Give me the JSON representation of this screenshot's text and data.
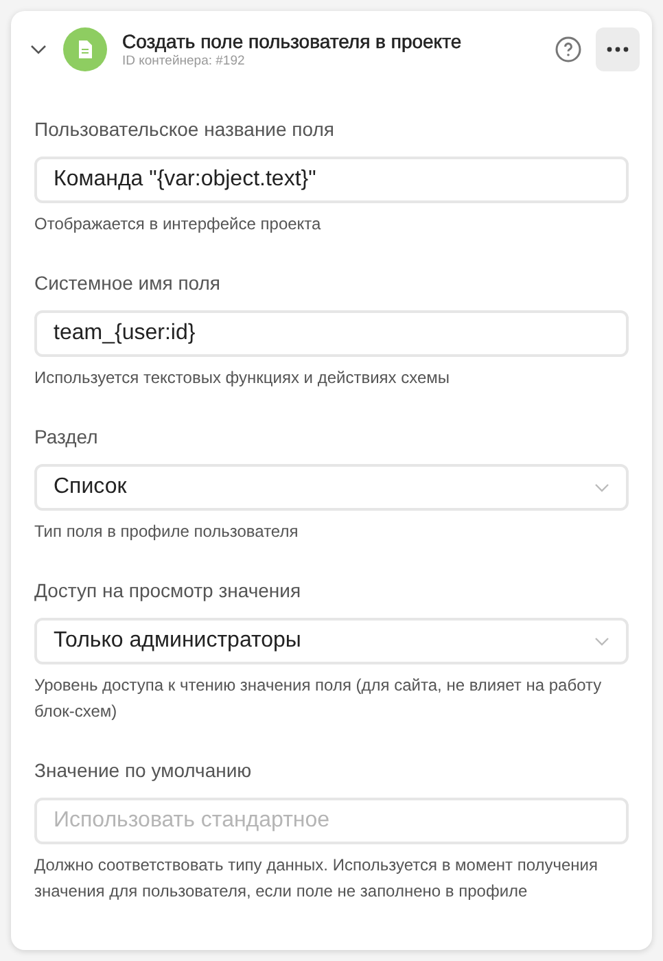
{
  "header": {
    "title": "Создать поле пользователя в проекте",
    "subtitle": "ID контейнера: #192",
    "expanded": true
  },
  "fields": [
    {
      "kind": "text",
      "label": "Пользовательское название поля",
      "value": "Команда \"{var:object.text}\"",
      "hint": "Отображается в интерфейсе проекта"
    },
    {
      "kind": "text",
      "label": "Системное имя поля",
      "value": "team_{user:id}",
      "hint": "Используется текстовых функциях и действиях схемы"
    },
    {
      "kind": "select",
      "label": "Раздел",
      "value": "Список",
      "hint": "Тип поля в профиле пользователя"
    },
    {
      "kind": "select",
      "label": "Доступ на просмотр значения",
      "value": "Только администраторы",
      "hint": "Уровень доступа к чтению значения поля (для сайта, не влияет на работу блок-схем)"
    },
    {
      "kind": "text",
      "label": "Значение по умолчанию",
      "placeholder": "Использовать стандартное",
      "hint": "Должно соответствовать типу данных. Используется в момент получения значения для пользователя, если поле не заполнено в профиле"
    }
  ]
}
